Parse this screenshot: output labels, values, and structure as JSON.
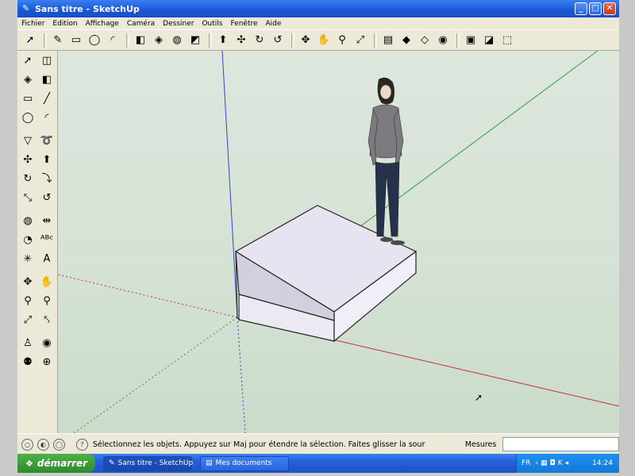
{
  "window": {
    "title": "Sans titre - SketchUp",
    "app_icon": "sketchup-pencil-icon",
    "buttons": [
      "_",
      "□",
      "✕"
    ]
  },
  "menu": [
    "Fichier",
    "Edition",
    "Affichage",
    "Caméra",
    "Dessiner",
    "Outils",
    "Fenêtre",
    "Aide"
  ],
  "top_toolbar": {
    "tools": [
      {
        "name": "select-icon",
        "glyph": "➚"
      },
      {
        "name": "pencil-icon",
        "glyph": "✎"
      },
      {
        "name": "rectangle-icon",
        "glyph": "▭"
      },
      {
        "name": "circle-icon",
        "glyph": "◯"
      },
      {
        "name": "arc-icon",
        "glyph": "◜"
      },
      {
        "name": "eraser-icon",
        "glyph": "◧"
      },
      {
        "name": "paint-bucket-icon",
        "glyph": "◈"
      },
      {
        "name": "tape-measure-icon",
        "glyph": "◍"
      },
      {
        "name": "text-icon",
        "glyph": "◩"
      },
      {
        "name": "push-pull-icon",
        "glyph": "⬆"
      },
      {
        "name": "move-icon",
        "glyph": "✣"
      },
      {
        "name": "rotate-icon",
        "glyph": "↻"
      },
      {
        "name": "offset-icon",
        "glyph": "↺"
      },
      {
        "name": "orbit-icon",
        "glyph": "✥"
      },
      {
        "name": "pan-icon",
        "glyph": "✋"
      },
      {
        "name": "zoom-icon",
        "glyph": "⚲"
      },
      {
        "name": "zoom-extents-icon",
        "glyph": "⤢"
      },
      {
        "name": "section-plane-icon",
        "glyph": "▤"
      },
      {
        "name": "get-models-icon",
        "glyph": "◆"
      },
      {
        "name": "share-model-icon",
        "glyph": "◇"
      },
      {
        "name": "google-earth-icon",
        "glyph": "◉"
      },
      {
        "name": "components-icon",
        "glyph": "▣"
      },
      {
        "name": "materials-icon",
        "glyph": "◪"
      },
      {
        "name": "styles-icon",
        "glyph": "⬚"
      }
    ]
  },
  "left_toolbar": {
    "rows": [
      [
        {
          "name": "select-icon",
          "glyph": "➚"
        },
        {
          "name": "make-component-icon",
          "glyph": "◫"
        }
      ],
      [
        {
          "name": "paint-bucket-icon",
          "glyph": "◈"
        },
        {
          "name": "eraser-icon",
          "glyph": "◧"
        }
      ],
      [
        {
          "name": "rectangle-icon",
          "glyph": "▭"
        },
        {
          "name": "line-icon",
          "glyph": "╱"
        }
      ],
      [
        {
          "name": "circle-icon",
          "glyph": "◯"
        },
        {
          "name": "arc-icon",
          "glyph": "◜"
        }
      ],
      [
        {
          "name": "polygon-icon",
          "glyph": "▽"
        },
        {
          "name": "freehand-icon",
          "glyph": "➰"
        }
      ],
      [
        {
          "name": "move-icon",
          "glyph": "✣"
        },
        {
          "name": "push-pull-icon",
          "glyph": "⬆"
        }
      ],
      [
        {
          "name": "rotate-icon",
          "glyph": "↻"
        },
        {
          "name": "follow-me-icon",
          "glyph": "⤵"
        }
      ],
      [
        {
          "name": "scale-icon",
          "glyph": "⤡"
        },
        {
          "name": "offset-icon",
          "glyph": "↺"
        }
      ],
      [
        {
          "name": "tape-measure-icon",
          "glyph": "◍"
        },
        {
          "name": "dimension-icon",
          "glyph": "⇹"
        }
      ],
      [
        {
          "name": "protractor-icon",
          "glyph": "◔"
        },
        {
          "name": "text-icon",
          "glyph": "ᴬᴮᶜ"
        }
      ],
      [
        {
          "name": "axes-icon",
          "glyph": "✳"
        },
        {
          "name": "3d-text-icon",
          "glyph": "A"
        }
      ],
      [
        {
          "name": "orbit-icon",
          "glyph": "✥"
        },
        {
          "name": "pan-icon",
          "glyph": "✋"
        }
      ],
      [
        {
          "name": "zoom-icon",
          "glyph": "⚲"
        },
        {
          "name": "zoom-window-icon",
          "glyph": "⚲"
        }
      ],
      [
        {
          "name": "zoom-extents-icon",
          "glyph": "⤢"
        },
        {
          "name": "previous-view-icon",
          "glyph": "⤣"
        }
      ],
      [
        {
          "name": "position-camera-icon",
          "glyph": "♙"
        },
        {
          "name": "look-around-icon",
          "glyph": "◉"
        }
      ],
      [
        {
          "name": "walk-icon",
          "glyph": "⚉"
        },
        {
          "name": "section-plane-icon",
          "glyph": "⊕"
        }
      ]
    ]
  },
  "status": {
    "text": "Sélectionnez les objets. Appuyez sur Maj pour étendre la sélection. Faites glisser la souris pour",
    "measures_label": "Mesures",
    "measures_value": ""
  },
  "taskbar": {
    "start_label": "démarrer",
    "tasks": [
      {
        "label": "Sans titre - SketchUp",
        "active": true
      },
      {
        "label": "Mes documents",
        "active": false
      }
    ],
    "tray": {
      "lang": "FR",
      "clock": "14:24"
    }
  }
}
